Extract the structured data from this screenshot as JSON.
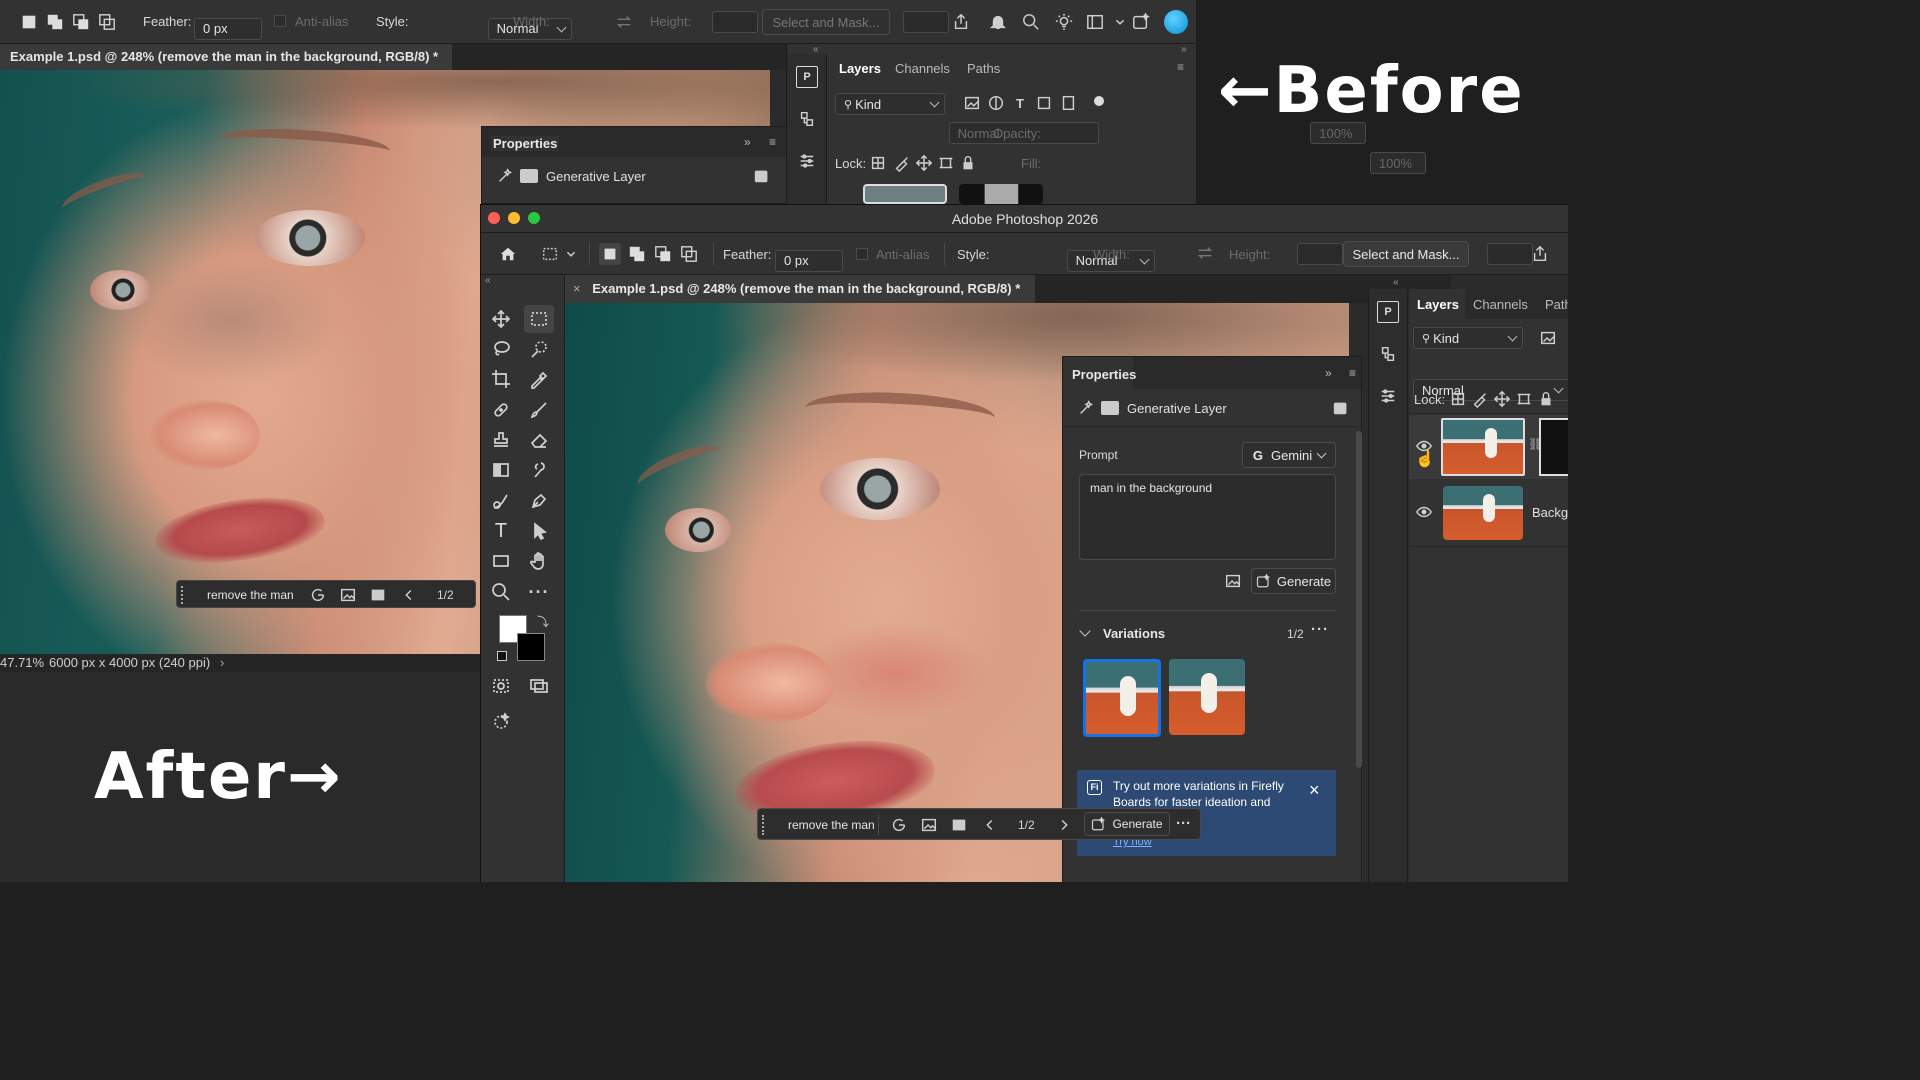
{
  "labels": {
    "before": "Before",
    "after": "After"
  },
  "before": {
    "options": {
      "feather_label": "Feather:",
      "feather_value": "0 px",
      "antialias_label": "Anti-alias",
      "style_label": "Style:",
      "style_value": "Normal",
      "width_label": "Width:",
      "height_label": "Height:",
      "select_mask": "Select and Mask..."
    },
    "doc_tab": "Example 1.psd @ 248% (remove the man in the background, RGB/8) *",
    "status": {
      "zoom": "47.71%",
      "size": "6000 px x 4000 px (240 ppi)"
    },
    "layers_tabs": [
      "Layers",
      "Channels",
      "Paths"
    ],
    "kind_value": "Kind",
    "blend_value": "Normal",
    "opacity_label": "Opacity:",
    "opacity_value": "100%",
    "lock_label": "Lock:",
    "fill_label": "Fill:",
    "fill_value": "100%",
    "properties": {
      "title": "Properties",
      "layer_type": "Generative Layer"
    },
    "taskbar": {
      "prompt": "remove the man",
      "page": "1/2"
    }
  },
  "after": {
    "window_title": "Adobe Photoshop 2026",
    "options": {
      "feather_label": "Feather:",
      "feather_value": "0 px",
      "antialias_label": "Anti-alias",
      "style_label": "Style:",
      "style_value": "Normal",
      "width_label": "Width:",
      "height_label": "Height:",
      "select_mask": "Select and Mask..."
    },
    "doc_tab": "Example 1.psd @ 248% (remove the man in the background, RGB/8) *",
    "layers_tabs": [
      "Layers",
      "Channels",
      "Path"
    ],
    "kind_value": "Kind",
    "blend_value": "Normal",
    "lock_label": "Lock:",
    "layer_bg_name": "Backg",
    "properties": {
      "title": "Properties",
      "layer_type": "Generative Layer",
      "prompt_label": "Prompt",
      "model": "Gemini",
      "prompt_text": "man in the background",
      "generate": "Generate",
      "variations_label": "Variations",
      "variations_count": "1/2",
      "tip_line1": "Try out more variations in Firefly",
      "tip_line2": "Boards for faster ideation and",
      "tip_link": "Try now"
    },
    "taskbar": {
      "prompt": "remove the man",
      "page": "1/2",
      "generate": "Generate"
    }
  },
  "colors": {
    "accent": "#1473e6",
    "tip_bg": "#2c4a73"
  }
}
